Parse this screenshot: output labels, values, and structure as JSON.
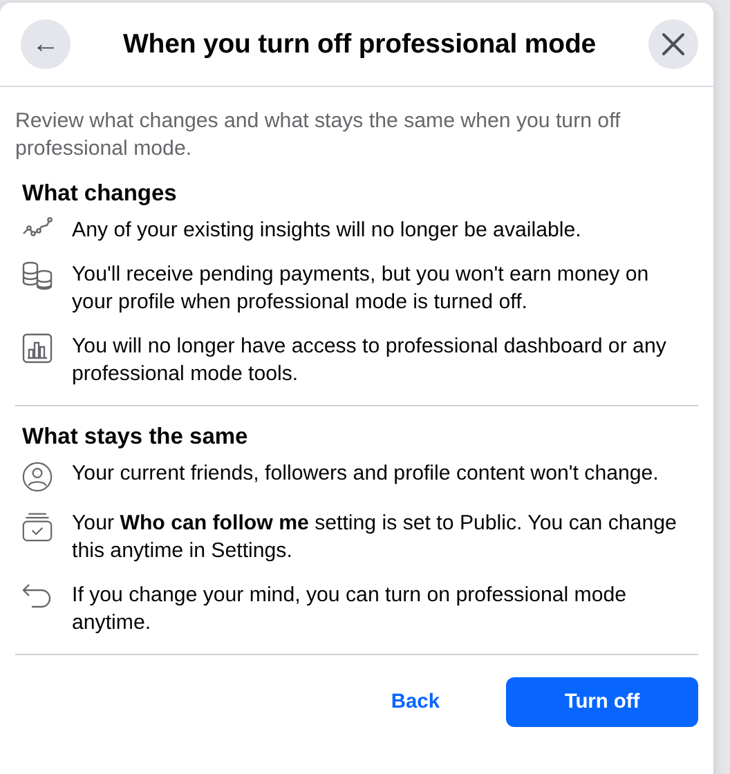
{
  "dialog": {
    "title": "When you turn off professional mode",
    "back_icon": "←",
    "intro": "Review what changes and what stays the same when you turn off professional mode."
  },
  "sections": [
    {
      "heading": "What changes",
      "items": [
        {
          "kind": "insights",
          "text": "Any of your existing insights will no longer be available."
        },
        {
          "kind": "coins",
          "text": "You'll receive pending payments, but you won't earn money on your profile when professional mode is turned off."
        },
        {
          "kind": "dashboard",
          "text": "You will no longer have access to professional dashboard or any professional mode tools."
        }
      ]
    },
    {
      "heading": "What stays the same",
      "items": [
        {
          "kind": "profile",
          "text": "Your current friends, followers and profile content won't change."
        },
        {
          "kind": "follow",
          "text": "Your **Who can follow me** setting is set to Public. You can change this anytime in Settings."
        },
        {
          "kind": "undo",
          "text": "If you change your mind, you can turn on professional mode anytime."
        }
      ]
    }
  ],
  "buttons": [
    {
      "kind": "secondary",
      "label": "Back"
    },
    {
      "kind": "primary",
      "label": "Turn off"
    }
  ]
}
